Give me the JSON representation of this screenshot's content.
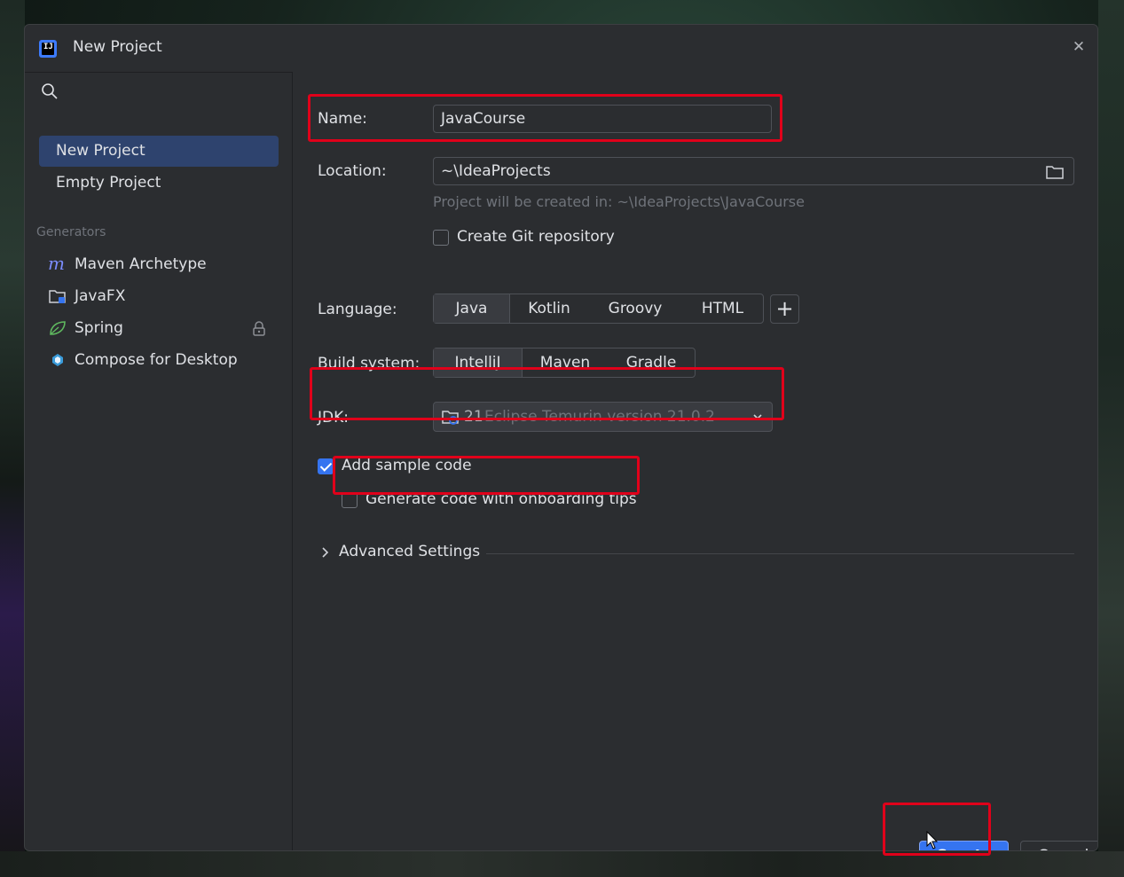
{
  "window": {
    "title": "New Project",
    "app_icon_letters": "IJ"
  },
  "sidebar": {
    "items": [
      {
        "label": "New Project",
        "selected": true
      },
      {
        "label": "Empty Project",
        "selected": false
      }
    ],
    "generators_label": "Generators",
    "generators": [
      {
        "label": "Maven Archetype",
        "icon": "maven-icon"
      },
      {
        "label": "JavaFX",
        "icon": "javafx-folder-icon"
      },
      {
        "label": "Spring",
        "icon": "spring-leaf-icon",
        "locked": true
      },
      {
        "label": "Compose for Desktop",
        "icon": "compose-icon"
      }
    ],
    "help_label": "?"
  },
  "form": {
    "name_label": "Name:",
    "name_value": "JavaCourse",
    "location_label": "Location:",
    "location_value": "~\\IdeaProjects",
    "location_hint": "Project will be created in: ~\\IdeaProjects\\JavaCourse",
    "git_label": "Create Git repository",
    "git_checked": false,
    "language_label": "Language:",
    "languages": [
      "Java",
      "Kotlin",
      "Groovy",
      "HTML"
    ],
    "language_selected": "Java",
    "add_language_label": "+",
    "build_label": "Build system:",
    "build_systems": [
      "IntelliJ",
      "Maven",
      "Gradle"
    ],
    "build_selected": "IntelliJ",
    "jdk_label": "JDK:",
    "jdk_version": "21",
    "jdk_name": "Eclipse Temurin version 21.0.2",
    "sample_code_label": "Add sample code",
    "sample_code_checked": true,
    "onboarding_label": "Generate code with onboarding tips",
    "onboarding_checked": false,
    "advanced_label": "Advanced Settings"
  },
  "buttons": {
    "create": "Create",
    "cancel": "Cancel"
  },
  "colors": {
    "accent": "#3574f0",
    "selection": "#2e436e",
    "annotation": "#e0001a"
  }
}
